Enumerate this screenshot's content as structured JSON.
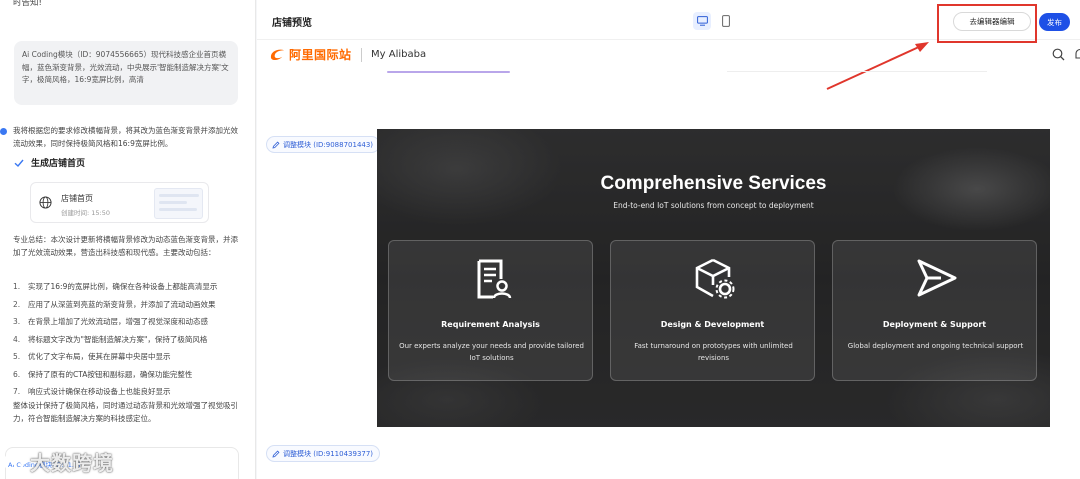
{
  "chat": {
    "top_snippet": "时告知!",
    "user_message": "Ai Coding模块（ID：9074556665）现代科技感企业首页横幅，蓝色渐变背景，光效流动，中央展示'智能制造解决方案'文字，极简风格，16:9宽屏比例，高清",
    "assistant_message": "我将根据您的要求修改横幅背景，将其改为蓝色渐变背景并添加光效流动效果，同时保持极简风格和16:9宽屏比例。",
    "step_label": "生成店铺首页",
    "card": {
      "title": "店铺首页",
      "time": "创建时间: 15:50"
    },
    "summary": "专业总结：本次设计更新将横幅背景修改为动态蓝色渐变背景，并添加了光效流动效果，营造出科技感和现代感。主要改动包括：",
    "items": [
      {
        "n": "1.",
        "text": "实现了16:9的宽屏比例，确保在各种设备上都能高清显示"
      },
      {
        "n": "2.",
        "text": "应用了从深蓝到亮蓝的渐变背景，并添加了流动动画效果"
      },
      {
        "n": "3.",
        "text": "在背景上增加了光效流动层，增强了视觉深度和动态感"
      },
      {
        "n": "4.",
        "text": "将标题文字改为\"智能制造解决方案\"，保持了极简风格"
      },
      {
        "n": "5.",
        "text": "优化了文字布局，使其在屏幕中央居中显示"
      },
      {
        "n": "6.",
        "text": "保持了原有的CTA按钮和副标题，确保功能完整性"
      },
      {
        "n": "7.",
        "text": "响应式设计确保在移动设备上也能良好显示"
      }
    ],
    "closing": "整体设计保持了极简风格，同时通过动态背景和光效增强了视觉吸引力，符合智能制造解决方案的科技感定位。",
    "input_ref": "Ai Coding模块(ID:91...)",
    "watermark": "大数跨境"
  },
  "preview": {
    "title": "店铺预览",
    "go_editor": "去编辑器编辑",
    "publish": "发布",
    "logo_text": "阿里国际站",
    "my_alibaba": "My Alibaba",
    "module_chip_1": "调整模块 (ID:9088701443)",
    "module_chip_2": "调整模块 (ID:9110439377)",
    "banner": {
      "title": "Comprehensive Services",
      "subtitle": "End-to-end IoT solutions from concept to deployment",
      "services": [
        {
          "title": "Requirement Analysis",
          "desc": "Our experts analyze your needs and provide tailored IoT solutions",
          "icon": "document-user-icon"
        },
        {
          "title": "Design & Development",
          "desc": "Fast turnaround on prototypes with unlimited revisions",
          "icon": "cube-gear-icon"
        },
        {
          "title": "Deployment & Support",
          "desc": "Global deployment and ongoing technical support",
          "icon": "send-icon"
        }
      ]
    }
  },
  "colors": {
    "accent": "#1e50e6",
    "brand_orange": "#ff6a00",
    "annotation_red": "#e0362c"
  }
}
